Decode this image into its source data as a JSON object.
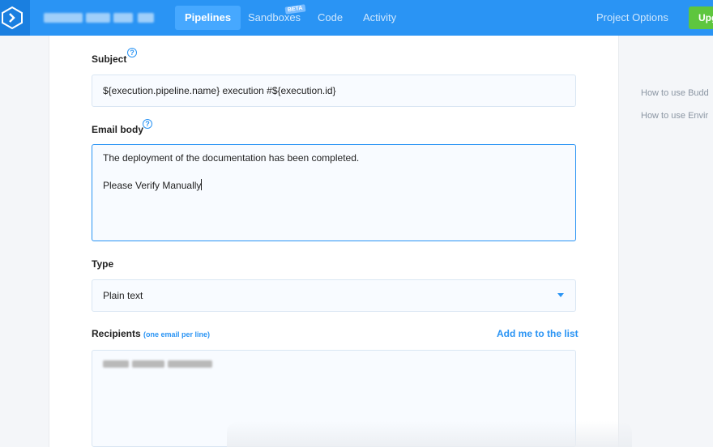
{
  "nav": {
    "items": [
      "Pipelines",
      "Sandboxes",
      "Code",
      "Activity"
    ],
    "beta_badge": "BETA",
    "project_options": "Project Options",
    "upgrade": "Upg"
  },
  "form": {
    "subject": {
      "label": "Subject",
      "value": "${execution.pipeline.name} execution #${execution.id}"
    },
    "email_body": {
      "label": "Email body",
      "value": "The deployment of the documentation has been completed.\n\nPlease Verify Manually"
    },
    "type": {
      "label": "Type",
      "selected": "Plain text"
    },
    "recipients": {
      "label": "Recipients",
      "hint": "(one email per line)",
      "add_me": "Add me to the list"
    }
  },
  "sidebar": {
    "links": [
      "How to use Budd",
      "How to use Envir"
    ]
  },
  "colors": {
    "topbar": "#2a94f4",
    "accent": "#2a94f4",
    "upgrade": "#5ec63e"
  }
}
